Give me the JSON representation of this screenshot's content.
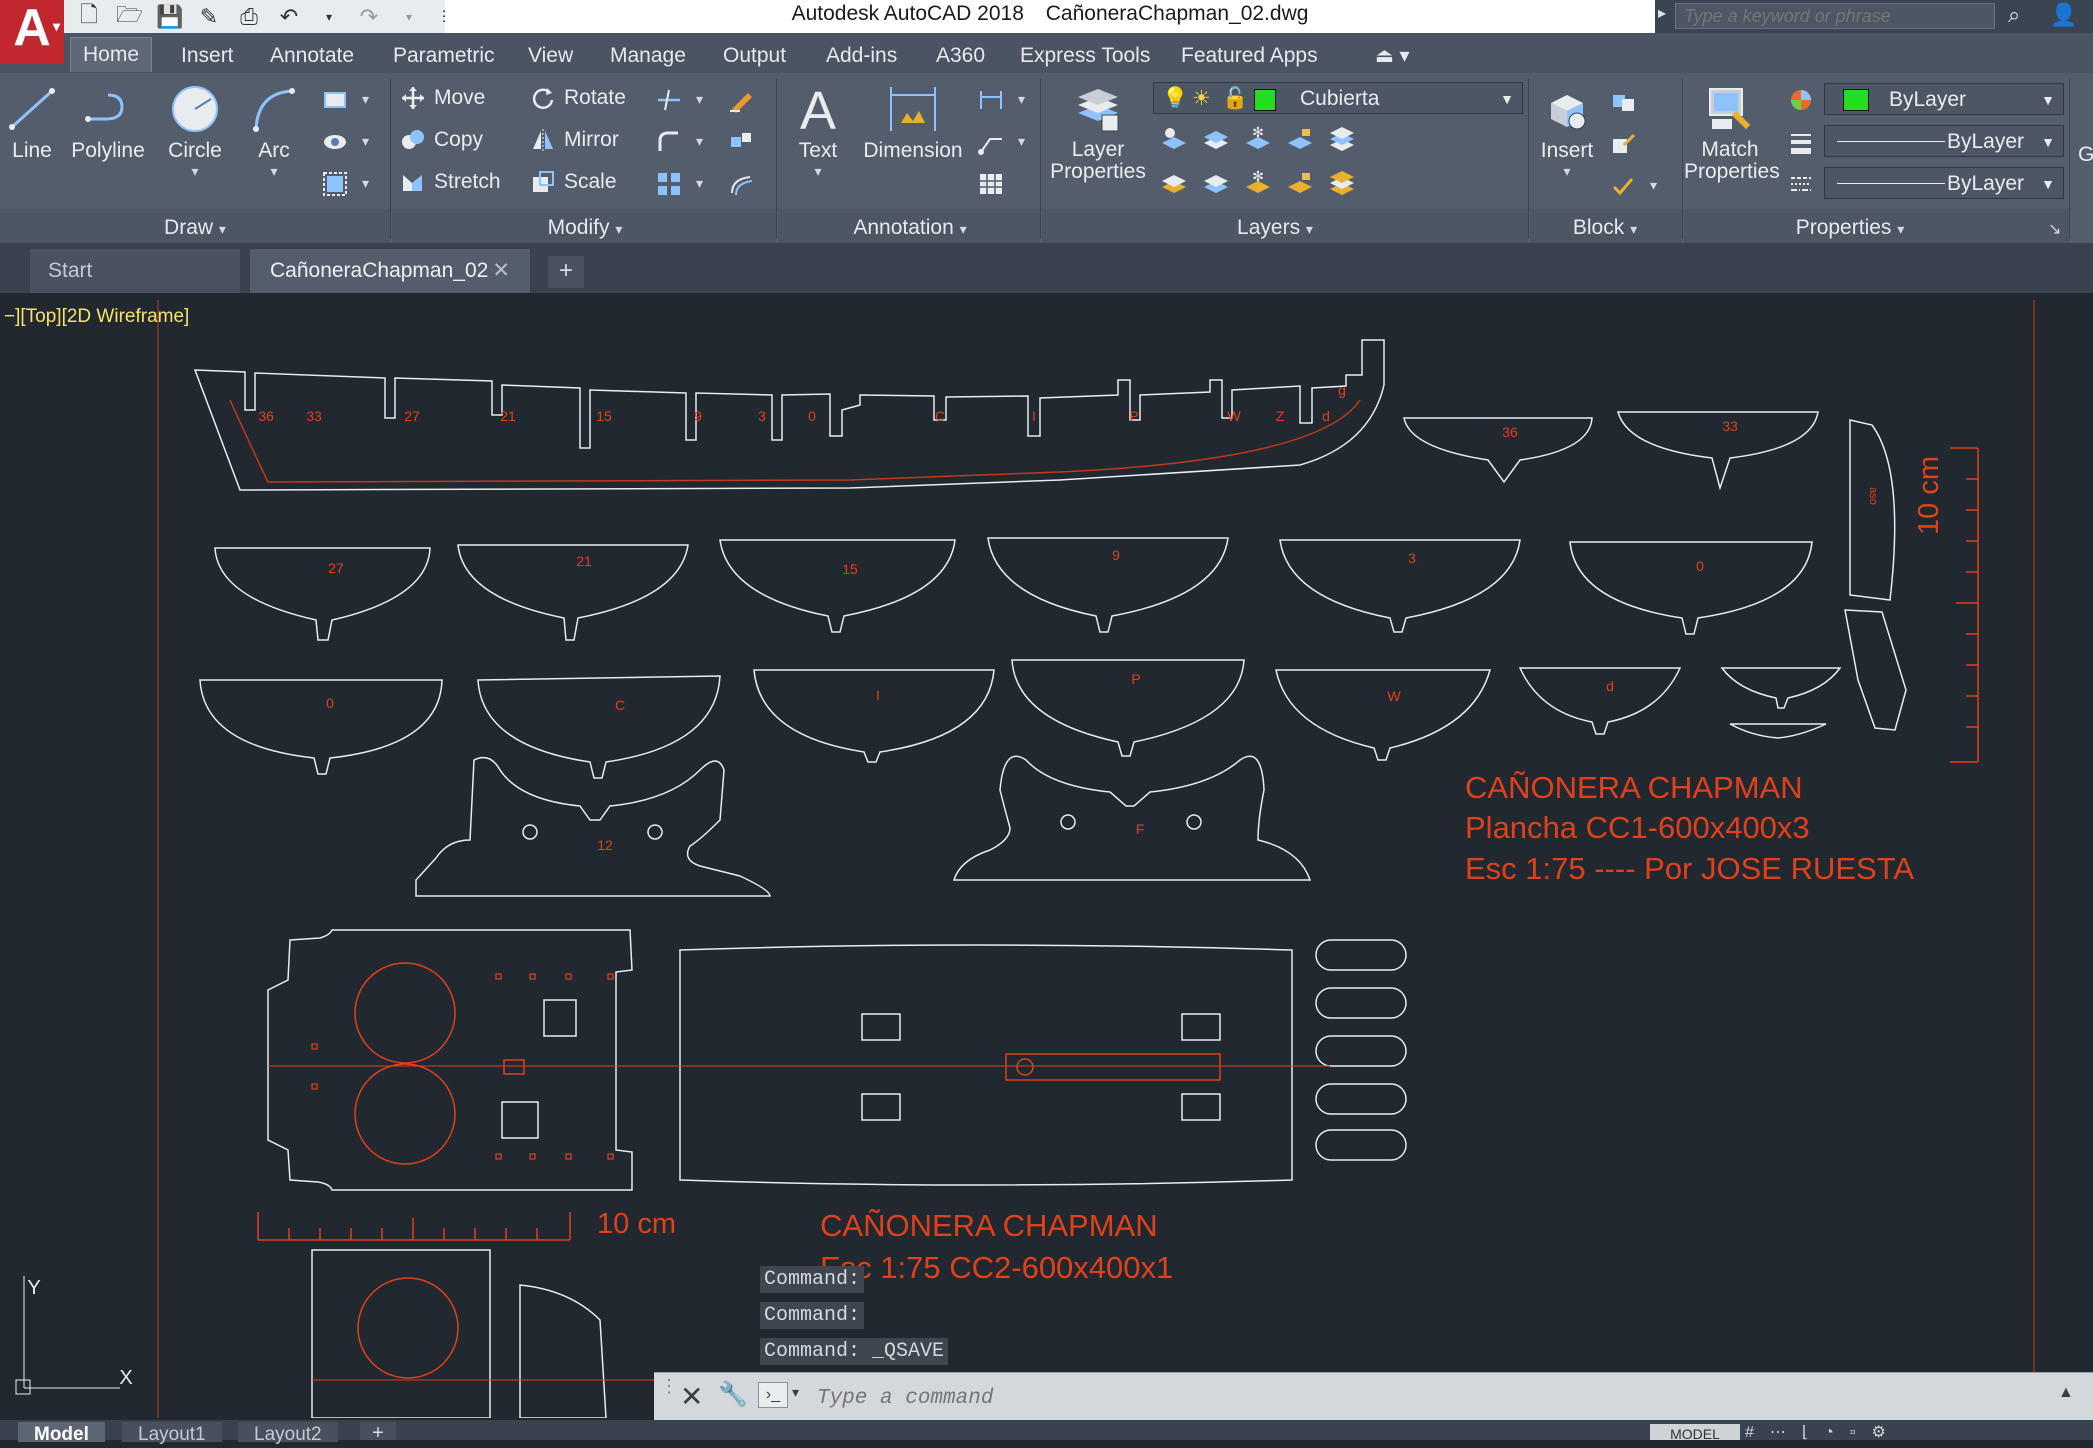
{
  "titlebar": {
    "app_name": "Autodesk AutoCAD 2018",
    "file_name": "CañoneraChapman_02.dwg",
    "search_placeholder": "Type a keyword or phrase",
    "logo_letter": "A"
  },
  "ribbon_tabs": [
    "Home",
    "Insert",
    "Annotate",
    "Parametric",
    "View",
    "Manage",
    "Output",
    "Add-ins",
    "A360",
    "Express Tools",
    "Featured Apps"
  ],
  "ribbon": {
    "draw": {
      "label": "Draw",
      "buttons": [
        "Line",
        "Polyline",
        "Circle",
        "Arc"
      ]
    },
    "modify": {
      "label": "Modify",
      "buttons": [
        "Move",
        "Rotate",
        "Copy",
        "Mirror",
        "Stretch",
        "Scale"
      ]
    },
    "annotation": {
      "label": "Annotation",
      "buttons": [
        "Text",
        "Dimension"
      ]
    },
    "layers": {
      "label": "Layers",
      "layer_properties": "Layer Properties",
      "current_layer": "Cubierta",
      "layer_color": "#22dd22"
    },
    "block": {
      "label": "Block",
      "insert": "Insert"
    },
    "properties": {
      "label": "Properties",
      "match_properties": "Match Properties",
      "color": "ByLayer",
      "linetype": "ByLayer",
      "lineweight": "ByLayer",
      "color_swatch": "#22dd22"
    },
    "partial_next": "G"
  },
  "file_tabs": {
    "start": "Start",
    "active": "CañoneraChapman_02"
  },
  "viewport": {
    "label": "−][Top][2D Wireframe]"
  },
  "drawing": {
    "keel_labels": [
      "36",
      "33",
      "27",
      "21",
      "15",
      "9",
      "3",
      "0",
      "C",
      "I",
      "P",
      "W",
      "Z",
      "d",
      "g"
    ],
    "frames_row1": [
      "36",
      "33"
    ],
    "frames_row2": [
      "27",
      "21",
      "15",
      "9",
      "3",
      "0"
    ],
    "frames_row3": [
      "0",
      "C",
      "I",
      "P",
      "W",
      "d"
    ],
    "cradle_labels": [
      "12",
      "F"
    ],
    "stem_label": "aso",
    "title1": [
      "CAÑONERA CHAPMAN",
      "Plancha CC1-600x400x3",
      "Esc 1:75 ---- Por JOSE RUESTA"
    ],
    "title2": [
      "CAÑONERA CHAPMAN",
      "Esc 1:75 CC2-600x400x1"
    ],
    "scale_label_v": "10 cm",
    "scale_label_h": "10 cm",
    "ucs_y": "Y",
    "ucs_x": "X",
    "line_color": "#e8ecef",
    "accent_color": "#e0411b"
  },
  "command_line": {
    "history": [
      "Command:",
      "Command:",
      "Command:  _QSAVE"
    ],
    "placeholder": "Type a command"
  },
  "layout_tabs": [
    "Model",
    "Layout1",
    "Layout2"
  ],
  "status": {
    "model": "MODEL"
  }
}
